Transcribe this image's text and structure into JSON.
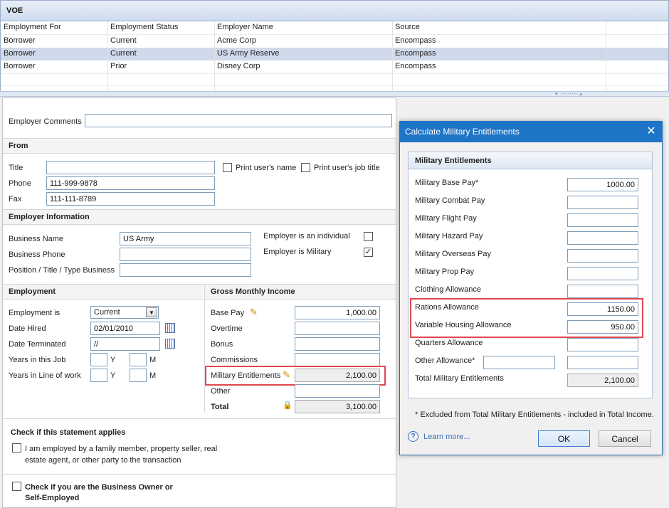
{
  "window": {
    "title": "VOE"
  },
  "grid": {
    "columns": [
      "Employment For",
      "Employment Status",
      "Employer Name",
      "Source"
    ],
    "rows": [
      [
        "Borrower",
        "Current",
        "Acme Corp",
        "Encompass"
      ],
      [
        "Borrower",
        "Current",
        "US Army Reserve",
        "Encompass"
      ],
      [
        "Borrower",
        "Prior",
        "Disney Corp",
        "Encompass"
      ]
    ],
    "selected_row": 1
  },
  "form": {
    "employer_comments_label": "Employer Comments",
    "employer_comments_value": "",
    "from": {
      "header": "From",
      "title_label": "Title",
      "title_value": "",
      "phone_label": "Phone",
      "phone_value": "111-999-9878",
      "fax_label": "Fax",
      "fax_value": "111-111-8789",
      "print_name_label": "Print user's name",
      "print_job_title_label": "Print user's job title"
    },
    "employer_info": {
      "header": "Employer Information",
      "business_name_label": "Business Name",
      "business_name_value": "US Army",
      "business_phone_label": "Business Phone",
      "business_phone_value": "",
      "position_label": "Position / Title / Type Business",
      "position_value": "",
      "is_individual_label": "Employer is an individual",
      "is_military_label": "Employer is Military",
      "is_individual_checked": "",
      "is_military_checked": "✓"
    },
    "employment": {
      "header": "Employment",
      "employment_is_label": "Employment is",
      "employment_is_value": "Current",
      "date_hired_label": "Date Hired",
      "date_hired_value": "02/01/2010",
      "date_terminated_label": "Date Terminated",
      "date_terminated_value": "//",
      "years_job_label": "Years in this Job",
      "years_line_label": "Years in Line of work",
      "y_label": "Y",
      "m_label": "M"
    },
    "income": {
      "header": "Gross Monthly Income",
      "base_pay_label": "Base Pay",
      "base_pay_value": "1,000.00",
      "overtime_label": "Overtime",
      "bonus_label": "Bonus",
      "commissions_label": "Commissions",
      "military_label": "Military Entitlements",
      "military_value": "2,100.00",
      "other_label": "Other",
      "total_label": "Total",
      "total_value": "3,100.00"
    },
    "check_statement": {
      "header": "Check if this statement applies",
      "item_line1": "I am employed by a family member, property seller, real",
      "item_line2": "estate agent, or other party to the transaction"
    },
    "business_owner": {
      "line1": "Check if you are the Business Owner or",
      "line2": "Self-Employed"
    }
  },
  "dialog": {
    "title": "Calculate Military Entitlements",
    "panel_header": "Military Entitlements",
    "fields": [
      {
        "label": "Military Base Pay*",
        "value": "1000.00"
      },
      {
        "label": "Military Combat Pay",
        "value": ""
      },
      {
        "label": "Military Flight Pay",
        "value": ""
      },
      {
        "label": "Military Hazard Pay",
        "value": ""
      },
      {
        "label": "Military Overseas Pay",
        "value": ""
      },
      {
        "label": "Military Prop Pay",
        "value": ""
      },
      {
        "label": "Clothing Allowance",
        "value": ""
      },
      {
        "label": "Rations Allowance",
        "value": "1150.00"
      },
      {
        "label": "Variable Housing Allowance",
        "value": "950.00"
      },
      {
        "label": "Quarters Allowance",
        "value": ""
      },
      {
        "label": "Other Allowance*",
        "value": ""
      },
      {
        "label": "Total Military Entitlements",
        "value": "2,100.00"
      }
    ],
    "other_allowance_desc": "",
    "footnote": "* Excluded from Total Military Entitlements - included in Total Income.",
    "learn_more": "Learn more...",
    "ok": "OK",
    "cancel": "Cancel"
  },
  "colors": {
    "highlight": "#e0474c",
    "dialog_title": "#1e74c6",
    "selected_row": "#cfd9ea"
  }
}
